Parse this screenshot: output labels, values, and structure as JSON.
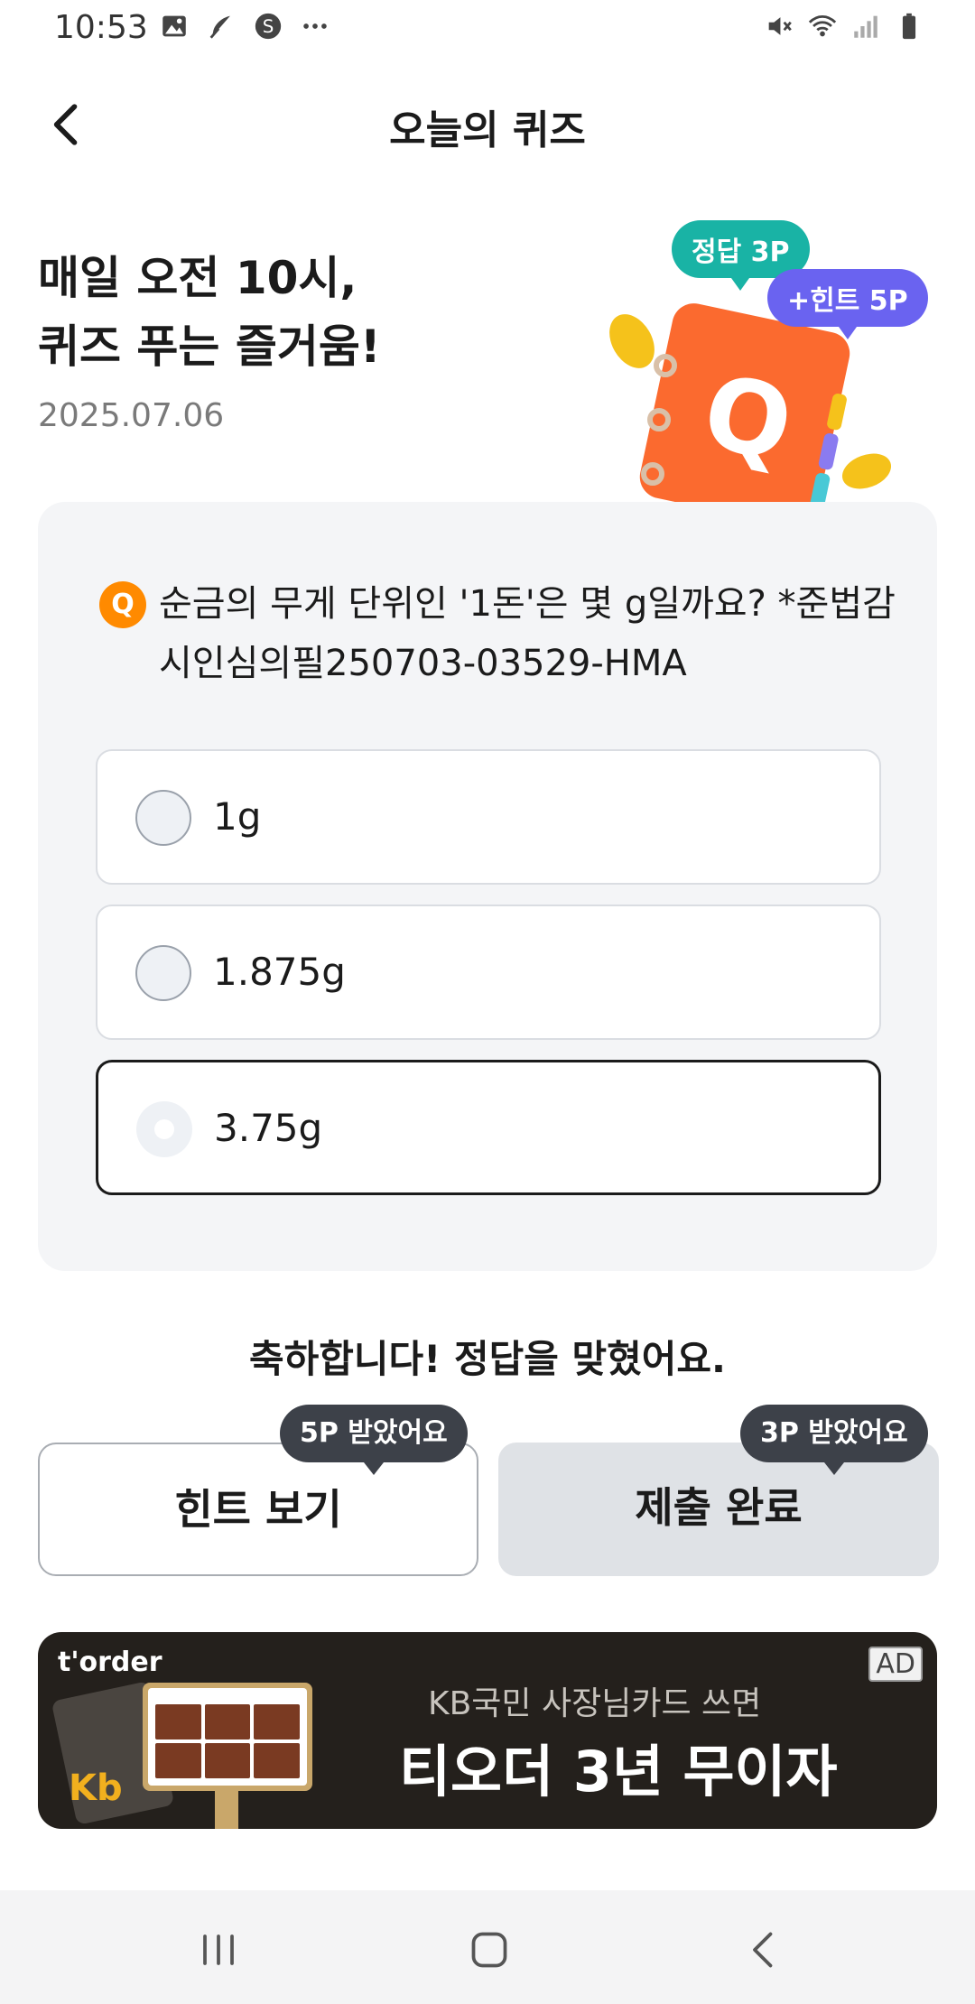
{
  "status_bar": {
    "time": "10:53",
    "left_icons": [
      "image-icon",
      "feather-icon",
      "s-circle-icon",
      "more-icon"
    ],
    "right_icons": [
      "mute-icon",
      "wifi-icon",
      "signal-icon",
      "battery-icon"
    ]
  },
  "app_bar": {
    "title": "오늘의 퀴즈"
  },
  "hero": {
    "title_line1": "매일 오전 10시,",
    "title_line2": "퀴즈 푸는 즐거움!",
    "date": "2025.07.06",
    "badge_correct": "정답 3P",
    "badge_hint": "+힌트 5P",
    "illustration_letter": "Q"
  },
  "question": {
    "badge": "Q",
    "text": "순금의 무게 단위인 '1돈'은 몇 g일까요? *준법감시인심의필250703-03529-HMA",
    "options": [
      {
        "label": "1g",
        "selected": false
      },
      {
        "label": "1.875g",
        "selected": false
      },
      {
        "label": "3.75g",
        "selected": true
      }
    ]
  },
  "result": {
    "message": "축하합니다! 정답을 맞혔어요."
  },
  "actions": {
    "hint_button": "힌트 보기",
    "hint_tip": "5P 받았어요",
    "submit_button": "제출 완료",
    "submit_tip": "3P 받았어요"
  },
  "ad": {
    "brand": "t'order",
    "tag": "AD",
    "subtitle": "KB국민 사장님카드 쓰면",
    "headline": "티오더 3년 무이자",
    "card_logo": "Kb"
  },
  "colors": {
    "accent_orange": "#ff8a00",
    "teal": "#19b3a5",
    "purple": "#6a63f0",
    "tooltip_dark": "#3d4149"
  }
}
